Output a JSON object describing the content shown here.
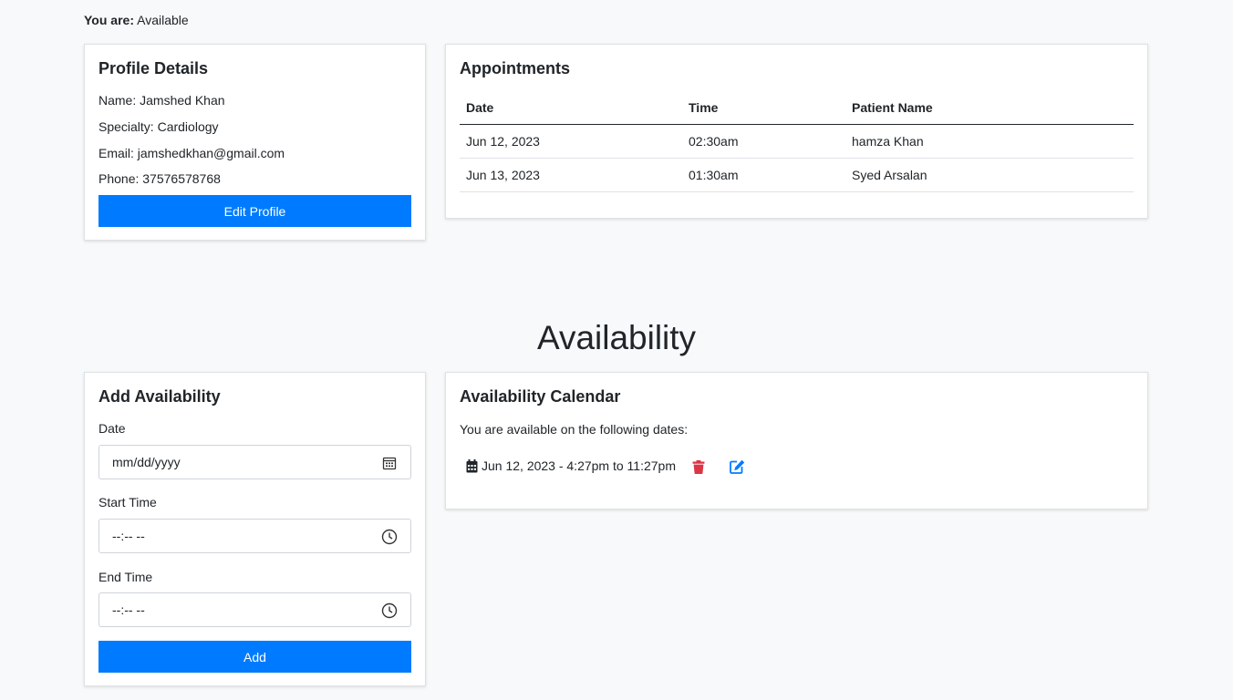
{
  "status": {
    "label": "You are:",
    "value": "Available"
  },
  "profile": {
    "title": "Profile Details",
    "name": "Name: Jamshed Khan",
    "specialty": "Specialty: Cardiology",
    "email": "Email: jamshedkhan@gmail.com",
    "phone": "Phone: 37576578768",
    "edit_label": "Edit Profile"
  },
  "appointments": {
    "title": "Appointments",
    "columns": [
      "Date",
      "Time",
      "Patient Name"
    ],
    "rows": [
      [
        "Jun 12, 2023",
        "02:30am",
        "hamza Khan"
      ],
      [
        "Jun 13, 2023",
        "01:30am",
        "Syed Arsalan"
      ]
    ]
  },
  "section_title": "Availability",
  "add_form": {
    "title": "Add Availability",
    "date_label": "Date",
    "date_placeholder": "mm/dd/yyyy",
    "start_label": "Start Time",
    "start_placeholder": "--:-- --",
    "end_label": "End Time",
    "end_placeholder": "--:-- --",
    "add_label": "Add"
  },
  "calendar": {
    "title": "Availability Calendar",
    "intro": "You are available on the following dates:",
    "entries": [
      {
        "text": "Jun 12, 2023 - 4:27pm to 11:27pm",
        "icon": "calendar-icon"
      }
    ],
    "delete_color": "#dc3545",
    "edit_color": "#007bff"
  },
  "colors": {
    "primary": "#007bff",
    "background": "#f8f9fa"
  }
}
